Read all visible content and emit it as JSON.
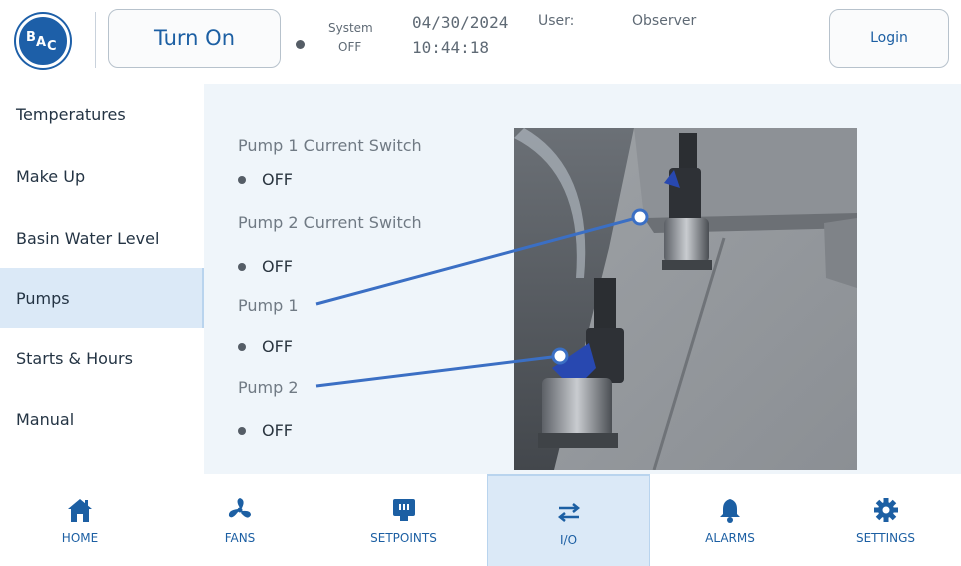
{
  "header": {
    "logo_text": "BAC",
    "turn_on_label": "Turn On",
    "system_label": "System",
    "system_value": "OFF",
    "date": "04/30/2024",
    "time": "10:44:18",
    "user_label": "User:",
    "user_value": "Observer",
    "login_label": "Login"
  },
  "sidebar": {
    "items": [
      {
        "label": "Temperatures"
      },
      {
        "label": "Make Up"
      },
      {
        "label": "Basin Water Level"
      },
      {
        "label": "Pumps"
      },
      {
        "label": "Starts & Hours"
      },
      {
        "label": "Manual"
      }
    ],
    "active": "Pumps"
  },
  "io": {
    "items": [
      {
        "title": "Pump 1 Current Switch",
        "status": "OFF"
      },
      {
        "title": "Pump 2 Current Switch",
        "status": "OFF"
      },
      {
        "title": "Pump 1",
        "status": "OFF"
      },
      {
        "title": "Pump 2",
        "status": "OFF"
      }
    ]
  },
  "bottomnav": {
    "items": [
      {
        "label": "HOME",
        "icon": "home-icon"
      },
      {
        "label": "FANS",
        "icon": "fan-icon"
      },
      {
        "label": "SETPOINTS",
        "icon": "setpoints-icon"
      },
      {
        "label": "I/O",
        "icon": "io-arrows-icon"
      },
      {
        "label": "ALARMS",
        "icon": "bell-icon"
      },
      {
        "label": "SETTINGS",
        "icon": "gear-icon"
      }
    ],
    "active": "I/O"
  },
  "colors": {
    "accent": "#1c5fa3",
    "active_bg": "#dbe9f7",
    "main_bg": "#eff5fa",
    "callout_line": "#3b6fc4"
  }
}
